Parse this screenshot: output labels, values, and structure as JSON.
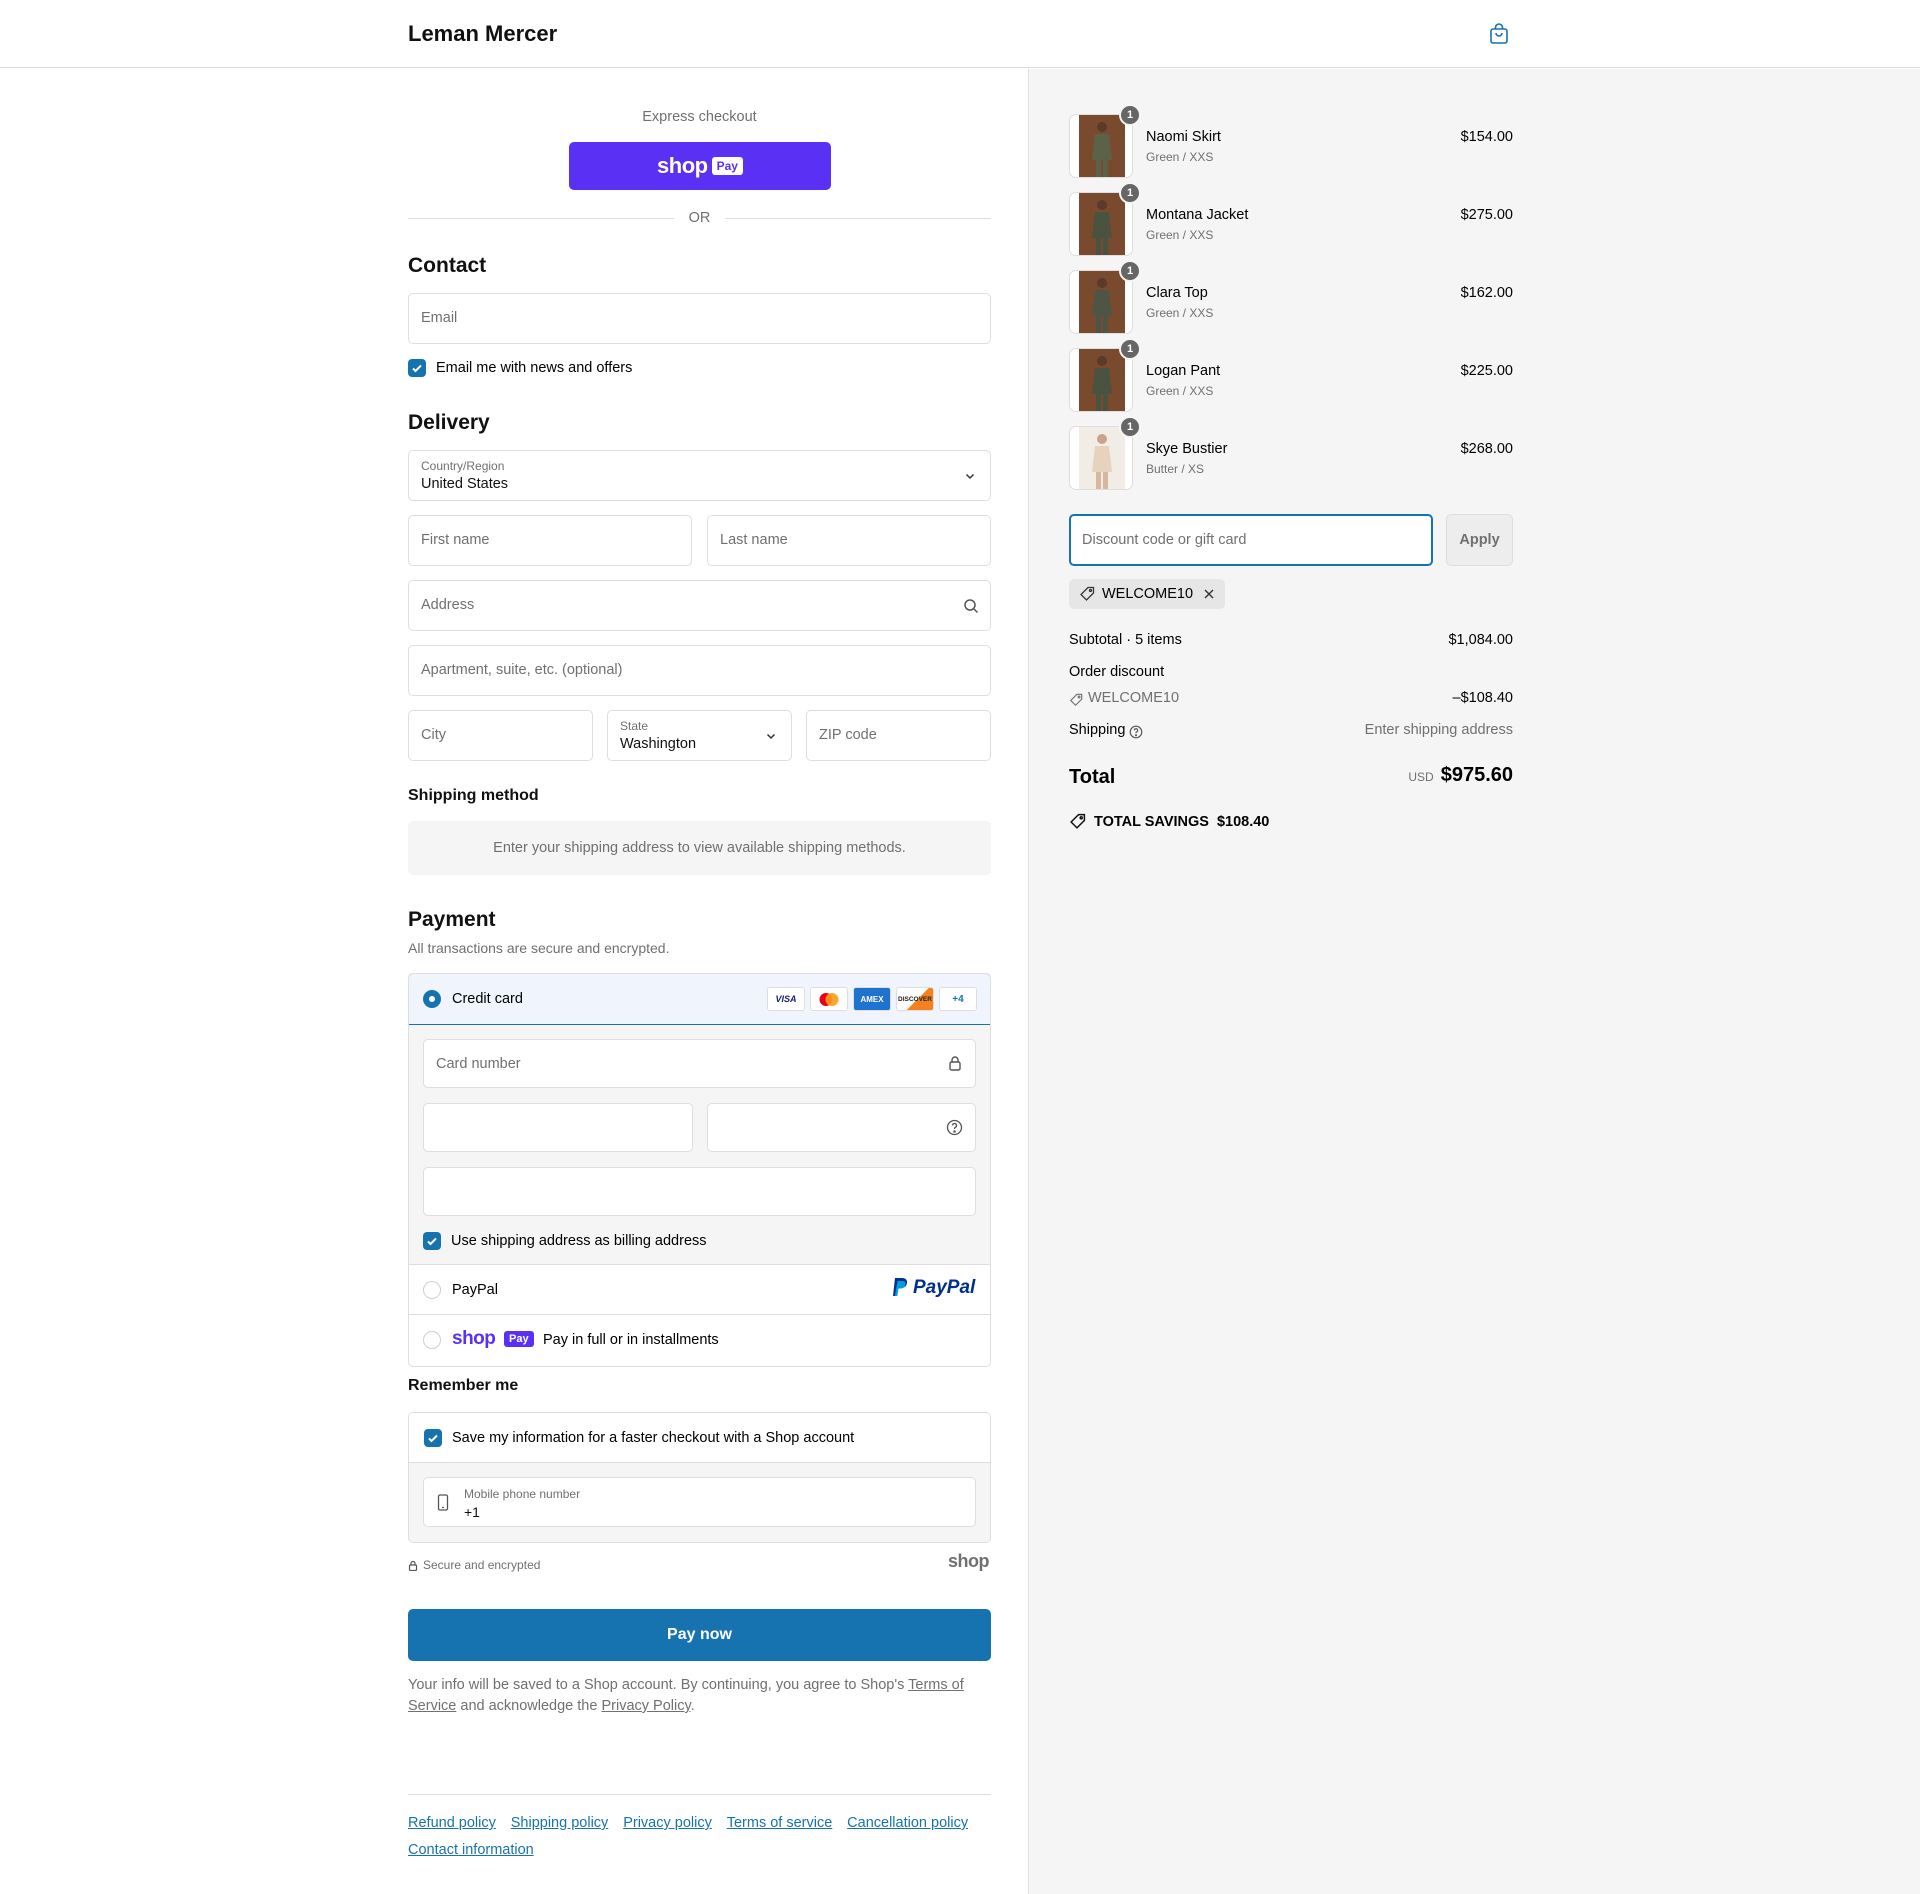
{
  "header": {
    "brand": "Leman Mercer"
  },
  "express": {
    "label": "Express checkout",
    "shop_word": "shop",
    "pay_word": "Pay",
    "or": "OR"
  },
  "contact": {
    "heading": "Contact",
    "email_placeholder": "Email",
    "newsletter_label": "Email me with news and offers"
  },
  "delivery": {
    "heading": "Delivery",
    "country_label": "Country/Region",
    "country_value": "United States",
    "first_name": "First name",
    "last_name": "Last name",
    "address": "Address",
    "apartment": "Apartment, suite, etc. (optional)",
    "city": "City",
    "state_label": "State",
    "state_value": "Washington",
    "zip": "ZIP code"
  },
  "shipping_method": {
    "heading": "Shipping method",
    "notice": "Enter your shipping address to view available shipping methods."
  },
  "payment": {
    "heading": "Payment",
    "subtitle": "All transactions are secure and encrypted.",
    "credit_card_label": "Credit card",
    "card_badges": [
      "VISA",
      "MC",
      "AMEX",
      "DISCOVER",
      "+4"
    ],
    "card_number": "Card number",
    "billing_same": "Use shipping address as billing address",
    "paypal_label": "PayPal",
    "paypal_logo": "PayPal",
    "shoppay_option": "Pay in full or in installments"
  },
  "remember": {
    "heading": "Remember me",
    "save_label": "Save my information for a faster checkout with a Shop account",
    "phone_label": "Mobile phone number",
    "phone_value": "+1",
    "secure": "Secure and encrypted",
    "shop_logo": "shop"
  },
  "pay_now": "Pay now",
  "legal": {
    "text_before": "Your info will be saved to a Shop account. By continuing, you agree to Shop's ",
    "terms_link": "Terms of Service",
    "text_middle": " and acknowledge the ",
    "privacy_link": "Privacy Policy",
    "text_after": "."
  },
  "footer_links": [
    "Refund policy",
    "Shipping policy",
    "Privacy policy",
    "Terms of service",
    "Cancellation policy",
    "Contact information"
  ],
  "summary": {
    "items": [
      {
        "name": "Naomi Skirt",
        "variant": "Green / XXS",
        "price": "$154.00",
        "qty": "1",
        "color": "#5c6248"
      },
      {
        "name": "Montana Jacket",
        "variant": "Green / XXS",
        "price": "$275.00",
        "qty": "1",
        "color": "#4a5240"
      },
      {
        "name": "Clara Top",
        "variant": "Green / XXS",
        "price": "$162.00",
        "qty": "1",
        "color": "#4f5544"
      },
      {
        "name": "Logan Pant",
        "variant": "Green / XXS",
        "price": "$225.00",
        "qty": "1",
        "color": "#4a5240"
      },
      {
        "name": "Skye Bustier",
        "variant": "Butter / XS",
        "price": "$268.00",
        "qty": "1",
        "color": "#e7d2bd"
      }
    ],
    "discount_placeholder": "Discount code or gift card",
    "apply": "Apply",
    "applied_code": "WELCOME10",
    "subtotal_label": "Subtotal · 5 items",
    "subtotal_value": "$1,084.00",
    "order_discount_label": "Order discount",
    "discount_code": "WELCOME10",
    "discount_value": "–$108.40",
    "shipping_label": "Shipping",
    "shipping_value": "Enter shipping address",
    "total_label": "Total",
    "currency": "USD",
    "total_value": "$975.60",
    "savings_label": "TOTAL SAVINGS",
    "savings_value": "$108.40"
  },
  "colors": {
    "accent": "#1773b0",
    "shop_purple": "#5a31f4",
    "paypal_dark": "#003087",
    "paypal_light": "#009cde"
  }
}
